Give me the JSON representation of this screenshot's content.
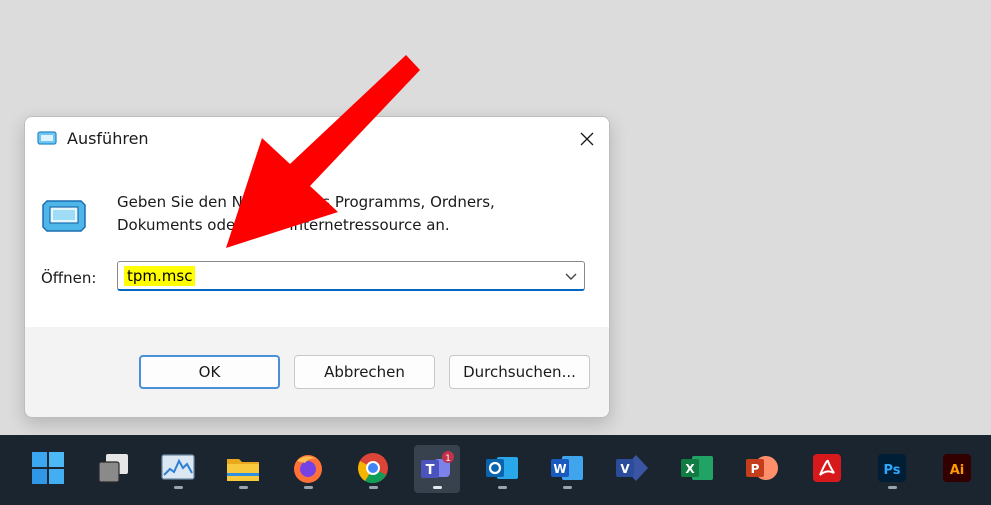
{
  "dialog": {
    "title": "Ausführen",
    "prompt_line1": "Geben Sie den Namen eines Programms, Ordners,",
    "prompt_line2": "Dokuments oder einer Internetressource an.",
    "open_label": "Öffnen:",
    "input_value": "tpm.msc",
    "ok_label": "OK",
    "cancel_label": "Abbrechen",
    "browse_label": "Durchsuchen...",
    "highlight_color": "#ffff00"
  },
  "annotation": {
    "arrow_color": "#ff0000"
  },
  "taskbar": {
    "items": [
      {
        "name": "start-icon"
      },
      {
        "name": "task-view-icon"
      },
      {
        "name": "resource-monitor-icon"
      },
      {
        "name": "file-explorer-icon"
      },
      {
        "name": "firefox-icon"
      },
      {
        "name": "chrome-icon"
      },
      {
        "name": "teams-icon",
        "badge": "1"
      },
      {
        "name": "outlook-icon"
      },
      {
        "name": "word-icon"
      },
      {
        "name": "visio-icon"
      },
      {
        "name": "excel-icon"
      },
      {
        "name": "powerpoint-icon"
      },
      {
        "name": "acrobat-icon"
      },
      {
        "name": "photoshop-icon",
        "label": "Ps"
      },
      {
        "name": "illustrator-icon",
        "label": "Ai"
      }
    ]
  }
}
